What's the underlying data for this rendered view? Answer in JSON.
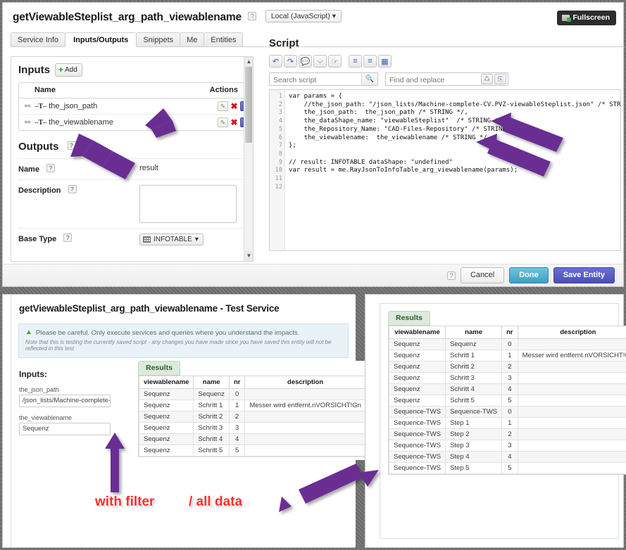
{
  "top_panel": {
    "service_title": "getViewableSteplist_arg_path_viewablename",
    "help_marker": "?",
    "language_selector": "Local (JavaScript)",
    "language_caret": "▾",
    "fullscreen_label": "Fullscreen",
    "tabs": [
      {
        "label": "Service Info",
        "active": false
      },
      {
        "label": "Inputs/Outputs",
        "active": true
      },
      {
        "label": "Snippets",
        "active": false
      },
      {
        "label": "Me",
        "active": false
      },
      {
        "label": "Entities",
        "active": false
      }
    ]
  },
  "inputs_section": {
    "heading": "Inputs",
    "add_label": "Add",
    "add_plus": "+",
    "columns": [
      "Name",
      "Actions"
    ],
    "rows": [
      {
        "name": "the_json_path",
        "type_glyph": "T"
      },
      {
        "name": "the_viewablename",
        "type_glyph": "T"
      }
    ],
    "action_icons": [
      "pencil-icon",
      "delete-icon",
      "goto-icon"
    ]
  },
  "outputs_section": {
    "heading": "Outputs",
    "help_marker": "?",
    "fields": [
      {
        "label": "Name",
        "value": "result"
      },
      {
        "label": "Description",
        "value": ""
      },
      {
        "label": "Base Type",
        "value": "INFOTABLE"
      }
    ],
    "base_type_caret": "▾"
  },
  "script_section": {
    "heading": "Script",
    "toolbar_buttons": [
      "undo-icon",
      "redo-icon",
      "add-comment-icon",
      "remove-comment-icon",
      "hand-icon",
      "indent-icon",
      "outdent-icon",
      "format-icon"
    ],
    "search_placeholder": "Search script",
    "search_value": "",
    "find_replace_placeholder": "Find and replace",
    "find_replace_value": "",
    "line_numbers": [
      "1",
      "2",
      "3",
      "4",
      "5",
      "6",
      "7",
      "8",
      "9",
      "10",
      "11",
      "12"
    ],
    "code_lines": [
      "var params = {",
      "    //the_json_path: \"/json_lists/Machine-complete-CV.PVZ-viewableSteplist.json\" /* STRING */,",
      "    the_json_path:  the_json_path /* STRING */,",
      "    the_dataShape_name: \"viewableSteplist\"  /* STRING */,",
      "    the_Repository_Name: \"CAD-Files-Repository\" /* STRING */,",
      "    the_viewablename:  the_viewablename /* STRING */",
      "};",
      "",
      "// result: INFOTABLE dataShape: \"undefined\"",
      "var result = me.RayJsonToInfoTable_arg_viewablename(params);",
      "",
      ""
    ]
  },
  "footer": {
    "help_marker": "?",
    "cancel_label": "Cancel",
    "done_label": "Done",
    "save_label": "Save Entity"
  },
  "test_panel": {
    "title": "getViewableSteplist_arg_path_viewablename - Test Service",
    "warning_line1": "Please be careful. Only execute services and queries where you understand the impacts.",
    "warning_line2": "Note that this is testing the currently saved script - any changes you have made since you have saved this entity will not be reflected in this test",
    "warning_icon": "warning-triangle-icon",
    "inputs_label": "Inputs:",
    "fields": [
      {
        "label": "the_json_path",
        "value": "/json_lists/Machine-complete-C"
      },
      {
        "label": "the_viewablename",
        "value": "Sequenz"
      }
    ],
    "results_tag": "Results",
    "columns": [
      "viewablename",
      "name",
      "nr",
      "description"
    ],
    "rows": [
      {
        "viewablename": "Sequenz",
        "name": "Sequenz",
        "nr": "0",
        "description": ""
      },
      {
        "viewablename": "Sequenz",
        "name": "Schritt 1",
        "nr": "1",
        "description": "Messer wird entfernt.nVORSICHT!Gn"
      },
      {
        "viewablename": "Sequenz",
        "name": "Schritt 2",
        "nr": "2",
        "description": ""
      },
      {
        "viewablename": "Sequenz",
        "name": "Schritt 3",
        "nr": "3",
        "description": ""
      },
      {
        "viewablename": "Sequenz",
        "name": "Schritt 4",
        "nr": "4",
        "description": ""
      },
      {
        "viewablename": "Sequenz",
        "name": "Schritt 5",
        "nr": "5",
        "description": ""
      }
    ]
  },
  "results_panel": {
    "results_tag": "Results",
    "columns": [
      "viewablename",
      "name",
      "nr",
      "description"
    ],
    "rows": [
      {
        "viewablename": "Sequenz",
        "name": "Sequenz",
        "nr": "0",
        "description": ""
      },
      {
        "viewablename": "Sequenz",
        "name": "Schritt 1",
        "nr": "1",
        "description": "Messer wird entfernt.nVORSICHT!Gn"
      },
      {
        "viewablename": "Sequenz",
        "name": "Schritt 2",
        "nr": "2",
        "description": ""
      },
      {
        "viewablename": "Sequenz",
        "name": "Schritt 3",
        "nr": "3",
        "description": ""
      },
      {
        "viewablename": "Sequenz",
        "name": "Schritt 4",
        "nr": "4",
        "description": ""
      },
      {
        "viewablename": "Sequenz",
        "name": "Schritt 5",
        "nr": "5",
        "description": ""
      },
      {
        "viewablename": "Sequence-TWS",
        "name": "Sequence-TWS",
        "nr": "0",
        "description": ""
      },
      {
        "viewablename": "Sequence-TWS",
        "name": "Step 1",
        "nr": "1",
        "description": ""
      },
      {
        "viewablename": "Sequence-TWS",
        "name": "Step 2",
        "nr": "2",
        "description": ""
      },
      {
        "viewablename": "Sequence-TWS",
        "name": "Step 3",
        "nr": "3",
        "description": ""
      },
      {
        "viewablename": "Sequence-TWS",
        "name": "Step 4",
        "nr": "4",
        "description": ""
      },
      {
        "viewablename": "Sequence-TWS",
        "name": "Step 5",
        "nr": "5",
        "description": ""
      }
    ]
  },
  "annotations": {
    "with_filter": "with filter",
    "all_data": "/ all data",
    "arrow_color": "#6b2f93",
    "text_color": "#ff2d2d"
  }
}
